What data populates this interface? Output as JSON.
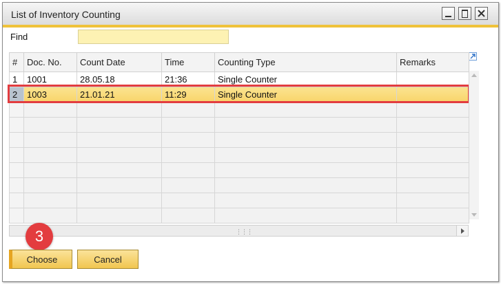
{
  "window": {
    "title": "List of Inventory Counting"
  },
  "find": {
    "label": "Find",
    "value": ""
  },
  "grid": {
    "columns": [
      "#",
      "Doc. No.",
      "Count Date",
      "Time",
      "Counting Type",
      "Remarks"
    ],
    "rows": [
      {
        "num": "1",
        "doc_no": "1001",
        "count_date": "28.05.18",
        "time": "21:36",
        "counting_type": "Single Counter",
        "remarks": ""
      },
      {
        "num": "2",
        "doc_no": "1003",
        "count_date": "21.01.21",
        "time": "11:29",
        "counting_type": "Single Counter",
        "remarks": ""
      }
    ],
    "selected_row": 2
  },
  "buttons": {
    "choose": "Choose",
    "cancel": "Cancel"
  },
  "annotation": {
    "step_number": "3"
  },
  "colors": {
    "selection": "#f8d46a",
    "highlight_outline": "#e33c3f",
    "accent": "#efc23a"
  },
  "icons": {
    "expand": "expand-arrow-icon",
    "minimize": "minimize-icon",
    "maximize": "maximize-icon",
    "close": "close-icon"
  }
}
